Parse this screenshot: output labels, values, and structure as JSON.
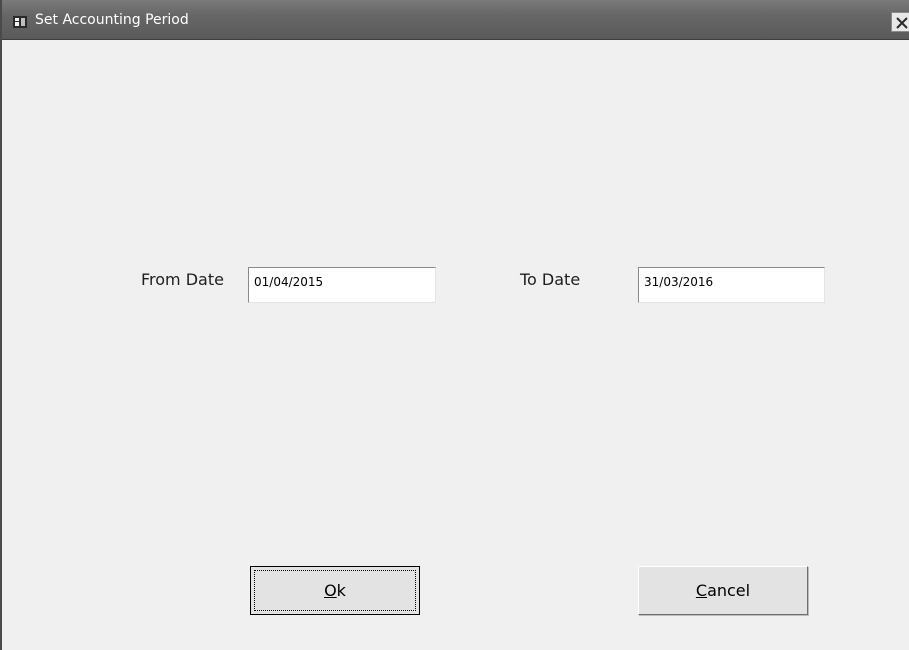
{
  "window": {
    "title": "Set Accounting Period",
    "icon": "app-icon",
    "close_icon": "close-icon"
  },
  "form": {
    "from_date_label": "From Date",
    "from_date_value": "01/04/2015",
    "to_date_label": "To Date",
    "to_date_value": "31/03/2016"
  },
  "buttons": {
    "ok": {
      "accel": "O",
      "rest": "k"
    },
    "cancel": {
      "accel": "C",
      "rest": "ancel"
    }
  },
  "colors": {
    "titlebar": "#666666",
    "client_bg": "#f0f0f0",
    "button_bg": "#e3e3e3"
  }
}
